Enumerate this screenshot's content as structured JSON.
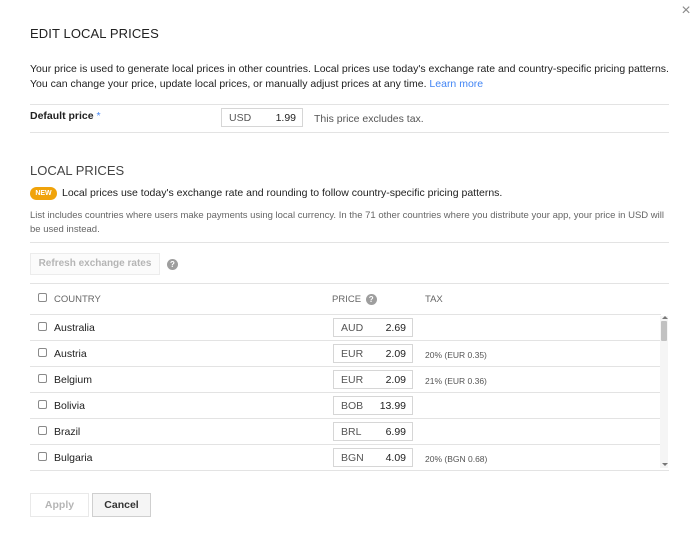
{
  "dialog": {
    "title": "EDIT LOCAL PRICES",
    "close_glyph": "×",
    "intro_text": "Your price is used to generate local prices in other countries. Local prices use today's exchange rate and country-specific pricing patterns. You can change your price, update local prices, or manually adjust prices at any time.",
    "learn_more": "Learn more"
  },
  "default_price": {
    "label": "Default price",
    "required_mark": "*",
    "currency": "USD",
    "value": "1.99",
    "note": "This price excludes tax."
  },
  "local_prices": {
    "title": "LOCAL PRICES",
    "badge": "NEW",
    "badge_color": "#f0a30a",
    "new_text": "Local prices use today's exchange rate and rounding to follow country-specific pricing patterns.",
    "note": "List includes countries where users make payments using local currency. In the 71 other countries where you distribute your app, your price in USD will be used instead.",
    "refresh_button": "Refresh exchange rates",
    "help_glyph": "?"
  },
  "table": {
    "columns": {
      "country": "COUNTRY",
      "price": "PRICE",
      "tax": "TAX"
    },
    "rows": [
      {
        "country": "Australia",
        "currency": "AUD",
        "price": "2.69",
        "tax": ""
      },
      {
        "country": "Austria",
        "currency": "EUR",
        "price": "2.09",
        "tax": "20% (EUR 0.35)"
      },
      {
        "country": "Belgium",
        "currency": "EUR",
        "price": "2.09",
        "tax": "21% (EUR 0.36)"
      },
      {
        "country": "Bolivia",
        "currency": "BOB",
        "price": "13.99",
        "tax": ""
      },
      {
        "country": "Brazil",
        "currency": "BRL",
        "price": "6.99",
        "tax": ""
      },
      {
        "country": "Bulgaria",
        "currency": "BGN",
        "price": "4.09",
        "tax": "20% (BGN 0.68)"
      }
    ]
  },
  "footer": {
    "apply": "Apply",
    "cancel": "Cancel"
  },
  "icons": {
    "close": "close-icon",
    "help": "help-circle-icon"
  },
  "colors": {
    "link": "#4285f4",
    "text": "#212121",
    "muted": "#666666"
  }
}
